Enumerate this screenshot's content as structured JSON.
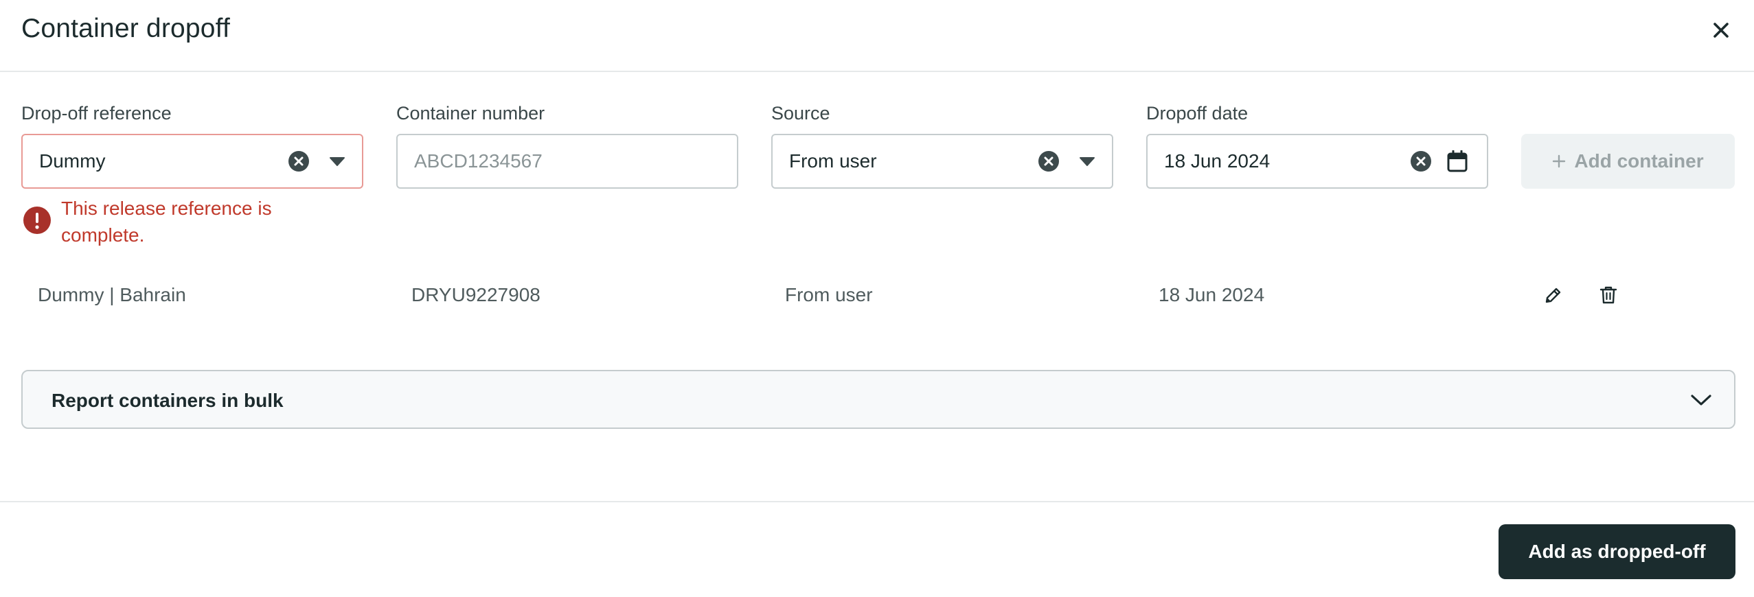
{
  "dialog": {
    "title": "Container dropoff",
    "close_icon": "close-icon"
  },
  "form": {
    "dropoff_reference": {
      "label": "Drop-off reference",
      "value": "Dummy",
      "error": "This release reference is complete.",
      "icons": [
        "clear-icon",
        "caret-down-icon",
        "error-icon"
      ]
    },
    "container_number": {
      "label": "Container number",
      "value": "",
      "placeholder": "ABCD1234567"
    },
    "source": {
      "label": "Source",
      "value": "From user",
      "icons": [
        "clear-icon",
        "caret-down-icon"
      ]
    },
    "dropoff_date": {
      "label": "Dropoff date",
      "value": "18 Jun 2024",
      "icons": [
        "clear-icon",
        "calendar-icon"
      ]
    },
    "add_container_label": "Add container",
    "add_container_icon": "plus-icon"
  },
  "containers": [
    {
      "reference": "Dummy | Bahrain",
      "number": "DRYU9227908",
      "source": "From user",
      "date": "18 Jun 2024",
      "actions": [
        "edit-icon",
        "trash-icon"
      ]
    }
  ],
  "bulk": {
    "title": "Report containers in bulk",
    "icon": "chevron-down-icon"
  },
  "footer": {
    "primary_label": "Add as dropped-off"
  },
  "colors": {
    "error": "#c0392b",
    "error_border": "#e89a95",
    "primary_button": "#1b2c2e",
    "disabled_button_bg": "#eef2f3"
  }
}
